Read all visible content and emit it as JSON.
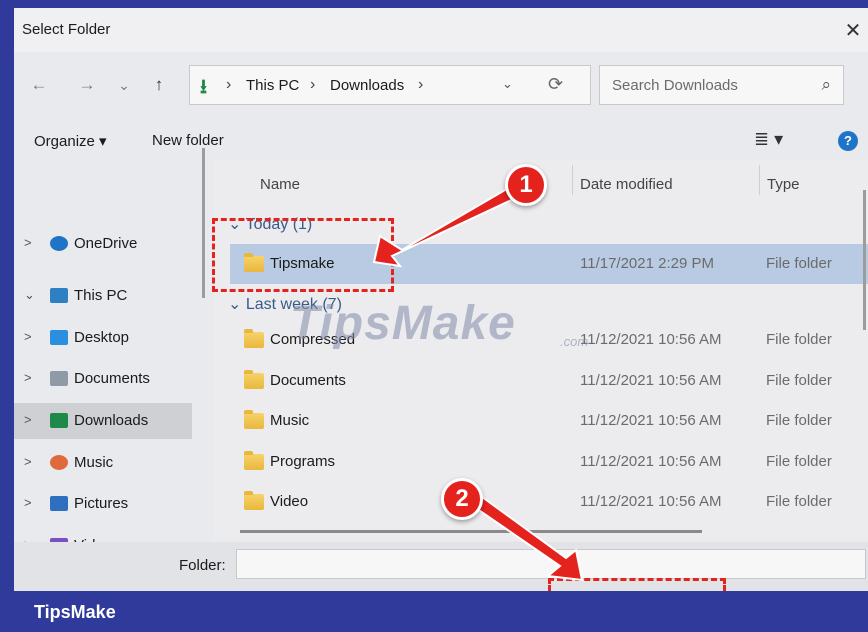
{
  "window": {
    "title": "Select Folder",
    "close_glyph": "✕"
  },
  "nav": {
    "back_glyph": "←",
    "forward_glyph": "→",
    "recent_glyph": "⌄",
    "up_glyph": "↑",
    "breadcrumbs": [
      "This PC",
      "Downloads"
    ],
    "separator": "›",
    "dropdown_glyph": "⌄",
    "refresh_glyph": "⟳",
    "search_placeholder": "Search Downloads",
    "search_glyph": "⌕"
  },
  "toolbar": {
    "organize": "Organize ▾",
    "new_folder": "New folder",
    "view_glyph": "≣ ▾",
    "help_glyph": "?"
  },
  "sidebar": {
    "items": [
      {
        "label": "OneDrive",
        "chevron": ">",
        "icon": "cloud-icon",
        "color": "#1f74c8"
      },
      {
        "label": "This PC",
        "chevron": "⌄",
        "icon": "monitor-icon",
        "color": "#2e7fc4"
      },
      {
        "label": "Desktop",
        "chevron": ">",
        "icon": "desktop-icon",
        "color": "#2b8fe0"
      },
      {
        "label": "Documents",
        "chevron": ">",
        "icon": "document-icon",
        "color": "#8f9aa6"
      },
      {
        "label": "Downloads",
        "chevron": ">",
        "icon": "download-icon",
        "color": "#1e8a4a"
      },
      {
        "label": "Music",
        "chevron": ">",
        "icon": "music-icon",
        "color": "#e06b3a"
      },
      {
        "label": "Pictures",
        "chevron": ">",
        "icon": "pictures-icon",
        "color": "#2f6fc0"
      },
      {
        "label": "Videos",
        "chevron": ">",
        "icon": "videos-icon",
        "color": "#7b4fc4"
      }
    ]
  },
  "columns": {
    "name": "Name",
    "date": "Date modified",
    "type": "Type"
  },
  "groups": {
    "today": "Today (1)",
    "last_week": "Last week (7)"
  },
  "today_rows": [
    {
      "name": "Tipsmake",
      "date": "11/17/2021 2:29 PM",
      "type": "File folder"
    }
  ],
  "week_rows": [
    {
      "name": "Compressed",
      "date": "11/12/2021 10:56 AM",
      "type": "File folder"
    },
    {
      "name": "Documents",
      "date": "11/12/2021 10:56 AM",
      "type": "File folder"
    },
    {
      "name": "Music",
      "date": "11/12/2021 10:56 AM",
      "type": "File folder"
    },
    {
      "name": "Programs",
      "date": "11/12/2021 10:56 AM",
      "type": "File folder"
    },
    {
      "name": "Video",
      "date": "11/12/2021 10:56 AM",
      "type": "File folder"
    }
  ],
  "footer": {
    "folder_label": "Folder:",
    "folder_value": ""
  },
  "brand": "TipsMake",
  "watermark": {
    "main": "TipsMake",
    "suffix": ".com"
  },
  "callouts": {
    "step1": "1",
    "step2": "2",
    "color": "#e4231f"
  }
}
